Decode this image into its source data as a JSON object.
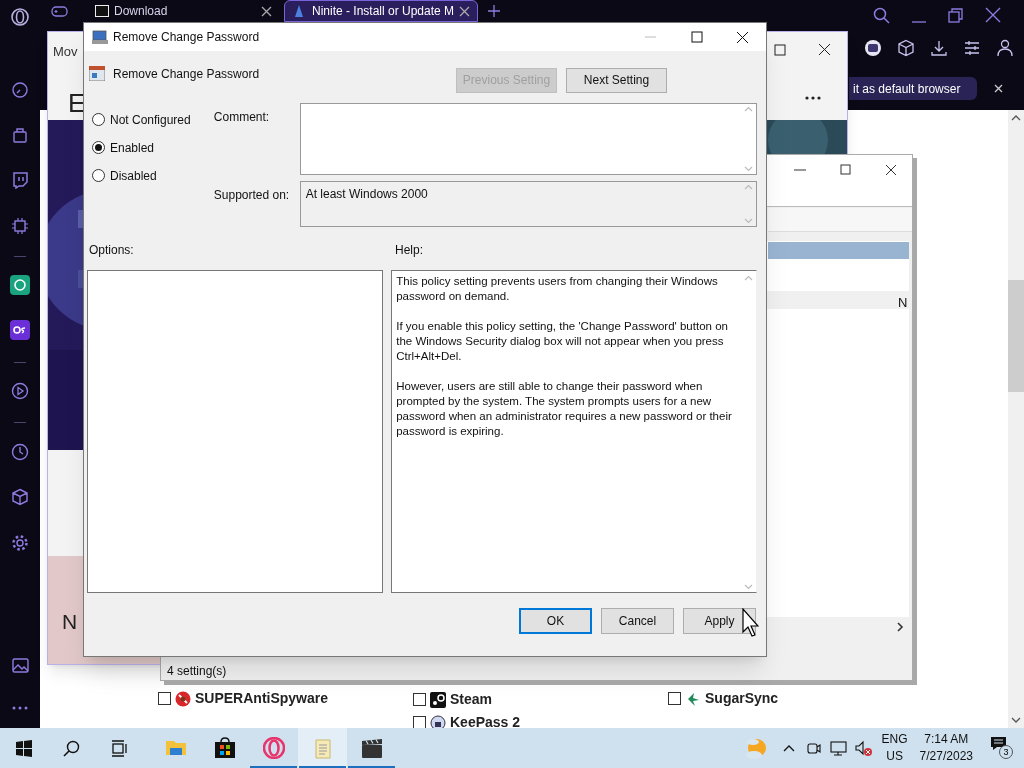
{
  "browser": {
    "tabs": [
      {
        "title": "Download",
        "selected": false
      },
      {
        "title": "Ninite - Install or Update M",
        "selected": true
      }
    ],
    "banner": "it as default browser",
    "apps": [
      {
        "name": "SUPERAntiSpyware",
        "checked": false,
        "kind": "shield"
      },
      {
        "name": "Steam",
        "checked": false,
        "kind": "steam"
      },
      {
        "name": "SugarSync",
        "checked": false,
        "kind": "bird"
      },
      {
        "name": "KeePass 2",
        "checked": false,
        "kind": "lock"
      }
    ]
  },
  "popup_window": {
    "title": "Mov",
    "heading": "E",
    "footer_text": "N"
  },
  "policy_editor": {
    "column_header": "N",
    "status_bar": "4 setting(s)"
  },
  "dialog": {
    "title": "Remove Change Password",
    "setting_name": "Remove Change Password",
    "nav_buttons": [
      {
        "label": "Previous Setting",
        "disabled": true
      },
      {
        "label": "Next Setting",
        "disabled": false
      }
    ],
    "states": [
      {
        "label": "Not Configured",
        "selected": false
      },
      {
        "label": "Enabled",
        "selected": true
      },
      {
        "label": "Disabled",
        "selected": false
      }
    ],
    "comment_label": "Comment:",
    "supported_label": "Supported on:",
    "supported_value": "At least Windows 2000",
    "options_label": "Options:",
    "help_label": "Help:",
    "help": [
      "This policy setting prevents users from changing their Windows password on demand.",
      "If you enable this policy setting,  the 'Change Password' button on the Windows Security dialog box will not appear when you press Ctrl+Alt+Del.",
      "However, users are still able to change their password when prompted by the system. The system prompts users for a new password when an administrator requires a new password or their password is expiring."
    ],
    "buttons": [
      {
        "label": "OK",
        "focused": true
      },
      {
        "label": "Cancel",
        "focused": false
      },
      {
        "label": "Apply",
        "focused": false
      }
    ]
  },
  "taskbar": {
    "apps": [
      {
        "kind": "explorer",
        "running": false,
        "selected": false
      },
      {
        "kind": "store",
        "running": false,
        "selected": false
      },
      {
        "kind": "opera",
        "running": true,
        "selected": false
      },
      {
        "kind": "notepad",
        "running": true,
        "selected": true
      },
      {
        "kind": "clapper",
        "running": true,
        "selected": false
      }
    ],
    "language": "ENG",
    "region": "US",
    "time": "7:14 AM",
    "date": "7/27/2023",
    "notifications": "3"
  }
}
